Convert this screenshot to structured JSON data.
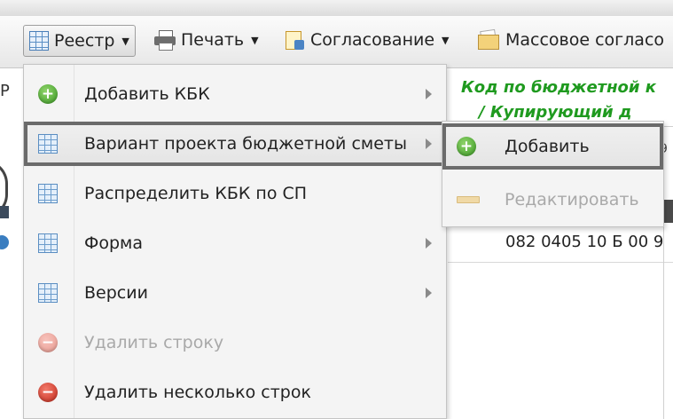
{
  "toolbar": {
    "registry_label": "Реестр",
    "print_label": "Печать",
    "approval_label": "Согласование",
    "mass_approval_label": "Массовое согласо"
  },
  "menu": {
    "items": [
      {
        "label": "Добавить КБК",
        "icon": "add-icon",
        "has_submenu": true,
        "disabled": false
      },
      {
        "label": "Вариант проекта бюджетной сметы",
        "icon": "table-icon",
        "has_submenu": true,
        "disabled": false,
        "highlighted": true
      },
      {
        "label": "Распределить КБК по СП",
        "icon": "table-icon",
        "has_submenu": false,
        "disabled": false
      },
      {
        "label": "Форма",
        "icon": "table-icon",
        "has_submenu": true,
        "disabled": false
      },
      {
        "label": "Версии",
        "icon": "table-icon",
        "has_submenu": true,
        "disabled": false
      },
      {
        "label": "Удалить строку",
        "icon": "delete-icon",
        "has_submenu": false,
        "disabled": true
      },
      {
        "label": "Удалить несколько строк",
        "icon": "delete-icon",
        "has_submenu": false,
        "disabled": false
      }
    ]
  },
  "submenu": {
    "items": [
      {
        "label": "Добавить",
        "icon": "add-icon",
        "disabled": false,
        "highlighted": true
      },
      {
        "label": "Редактировать",
        "icon": "pencil-icon",
        "disabled": true
      }
    ]
  },
  "grid": {
    "header_line1": "Код по бюджетной к",
    "header_line2": "/ Купирующий д",
    "left_letter": "Р",
    "peek_digit": "9",
    "code_value": "082 0405 10 Б 00 9"
  },
  "colors": {
    "header_green": "#1f9a1f",
    "highlight_border": "#6b6b6b",
    "disabled_text": "#a9a9a9"
  }
}
